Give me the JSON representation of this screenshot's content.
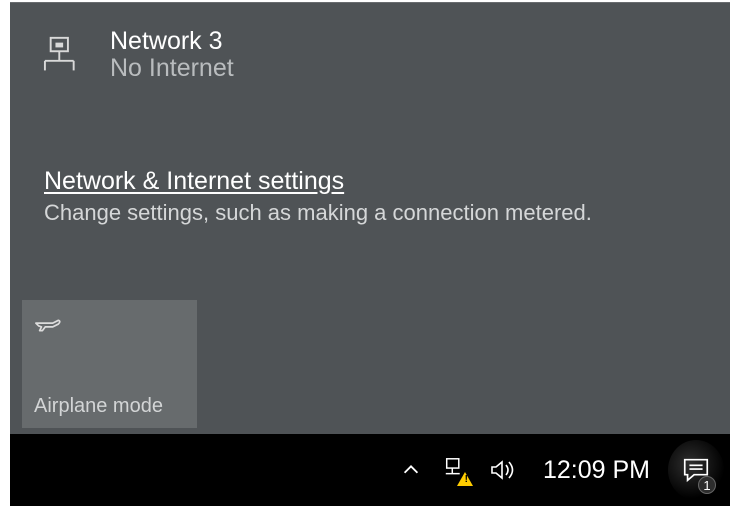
{
  "network": {
    "name": "Network  3",
    "status": "No Internet"
  },
  "settings": {
    "link": "Network & Internet settings",
    "description": "Change settings, such as making a connection metered."
  },
  "tiles": {
    "airplane": "Airplane mode"
  },
  "taskbar": {
    "clock": "12:09 PM",
    "notification_count": "1"
  }
}
